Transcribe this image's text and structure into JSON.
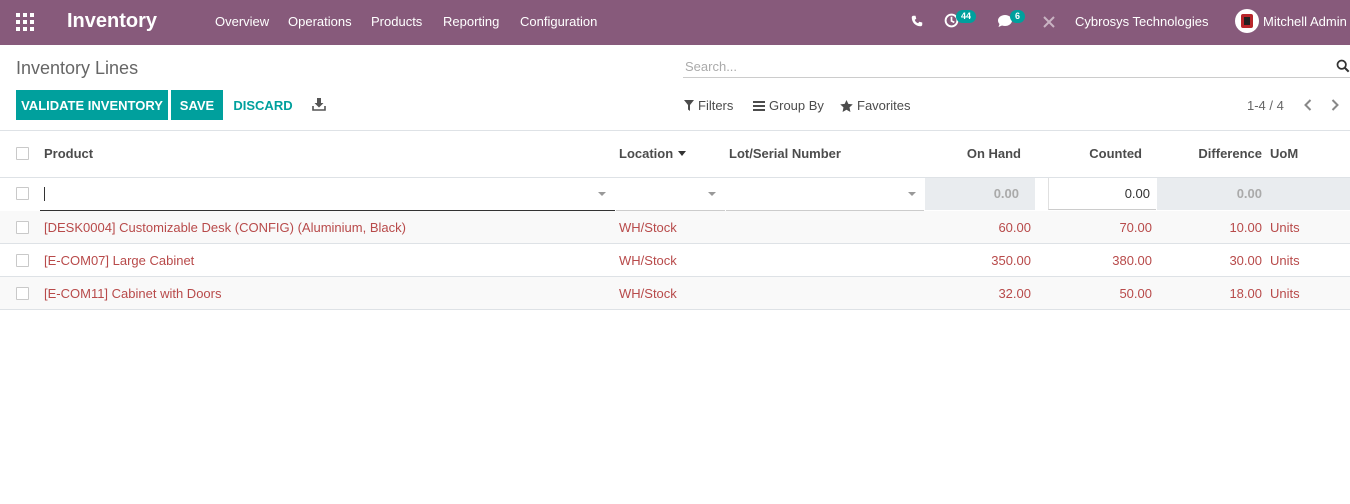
{
  "navbar": {
    "app_name": "Inventory",
    "menu": [
      "Overview",
      "Operations",
      "Products",
      "Reporting",
      "Configuration"
    ],
    "activity_count": "44",
    "message_count": "6",
    "company": "Cybrosys Technologies",
    "user": "Mitchell Admin"
  },
  "control_panel": {
    "breadcrumb": "Inventory Lines",
    "search_placeholder": "Search...",
    "validate_label": "VALIDATE INVENTORY",
    "save_label": "SAVE",
    "discard_label": "DISCARD",
    "filters_label": "Filters",
    "group_by_label": "Group By",
    "favorites_label": "Favorites",
    "pager": "1-4 / 4"
  },
  "table": {
    "columns": {
      "product": "Product",
      "location": "Location",
      "lot": "Lot/Serial Number",
      "on_hand": "On Hand",
      "counted": "Counted",
      "difference": "Difference",
      "uom": "UoM"
    },
    "edit_row": {
      "on_hand": "0.00",
      "counted": "0.00",
      "difference": "0.00"
    },
    "rows": [
      {
        "product": "[DESK0004] Customizable Desk (CONFIG) (Aluminium, Black)",
        "location": "WH/Stock",
        "lot": "",
        "on_hand": "60.00",
        "counted": "70.00",
        "difference": "10.00",
        "uom": "Units"
      },
      {
        "product": "[E-COM07] Large Cabinet",
        "location": "WH/Stock",
        "lot": "",
        "on_hand": "350.00",
        "counted": "380.00",
        "difference": "30.00",
        "uom": "Units"
      },
      {
        "product": "[E-COM11] Cabinet with Doors",
        "location": "WH/Stock",
        "lot": "",
        "on_hand": "32.00",
        "counted": "50.00",
        "difference": "18.00",
        "uom": "Units"
      }
    ]
  },
  "colors": {
    "navbar": "#875a7b",
    "primary": "#00a09d",
    "link_text": "#b84a4a"
  },
  "icons": [
    "apps-grid-icon",
    "phone-icon",
    "activity-clock-icon",
    "chat-icon",
    "close-x-icon",
    "search-icon",
    "download-icon",
    "filter-icon",
    "list-icon",
    "star-icon",
    "chevron-left-icon",
    "chevron-right-icon"
  ]
}
